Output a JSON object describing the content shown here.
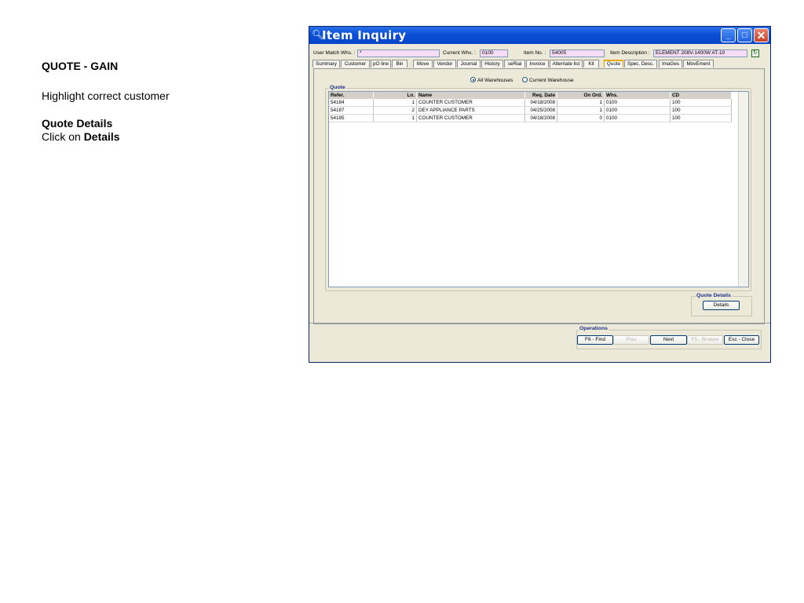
{
  "notes": {
    "title": "QUOTE - GAIN",
    "line1": "Highlight correct customer",
    "details_heading": "Quote Details",
    "click_prefix": "Click on",
    "click_target": "Details"
  },
  "window": {
    "title": "Item Inquiry",
    "controls": {
      "minimize": "_",
      "maximize": "□",
      "close": "✕"
    }
  },
  "header": {
    "user_match_label": "User Match Whs. :",
    "user_match_value": "*",
    "current_whs_label": "Current Whs. :",
    "current_whs_value": "0100",
    "item_no_label": "Item No. :",
    "item_no_value": "54005",
    "item_desc_label": "Item Description :",
    "item_desc_value": "ELEMENT 208V-1400W AT-10"
  },
  "tabs": [
    "Summary",
    "Customer",
    "pO line",
    "Bin",
    "Move",
    "Vendor",
    "Journal",
    "History",
    "seRial",
    "Invoice",
    "Alternate list",
    "Kit",
    "Quote",
    "Spec. Desc.",
    "ImaGes",
    "MovEment"
  ],
  "active_tab": "Quote",
  "filter": {
    "all_warehouses": "All Warehouses",
    "current_warehouse": "Current Warehouse",
    "selected": "All Warehouses"
  },
  "quote": {
    "group_label": "Quote",
    "columns": [
      "Refer.",
      "Ln.",
      "Name",
      "Req. Date",
      "On Ord.",
      "Whs.",
      "CD"
    ],
    "rows": [
      [
        "54184",
        "1",
        "COUNTER CUSTOMER",
        "04/18/2008",
        "1",
        "0100",
        "100"
      ],
      [
        "54187",
        "2",
        "DEY APPLIANCE PARTS",
        "04/25/2008",
        "1",
        "0100",
        "100"
      ],
      [
        "54185",
        "1",
        "COUNTER CUSTOMER",
        "04/18/2008",
        "0",
        "0100",
        "100"
      ]
    ]
  },
  "quote_details": {
    "group_label": "Quote  Details",
    "button": "Details"
  },
  "operations": {
    "group_label": "Operations",
    "find": "F6 - Find",
    "prev": "Prev",
    "next": "Next",
    "browse": "F5 - Browse",
    "close": "Esc - Close"
  }
}
